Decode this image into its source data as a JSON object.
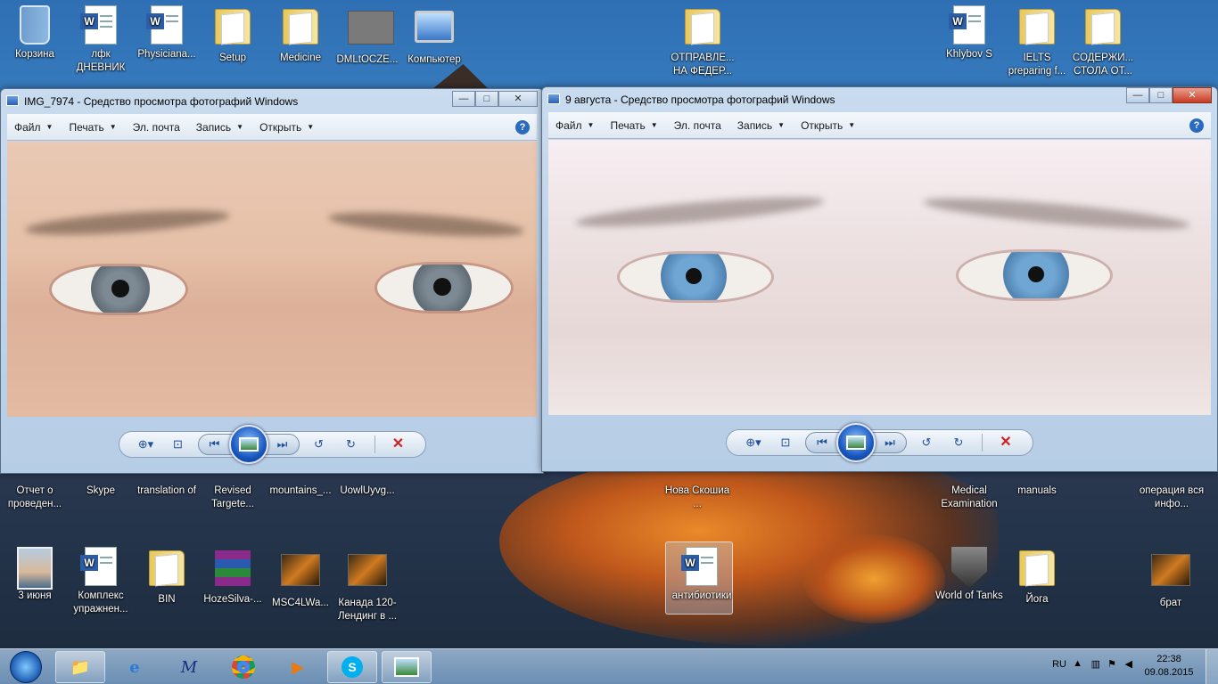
{
  "desktop": {
    "top_icons": [
      {
        "label": "Корзина",
        "kind": "bin"
      },
      {
        "label": "лфк ДНЕВНИК",
        "kind": "doc"
      },
      {
        "label": "Physiciana...",
        "kind": "doc"
      },
      {
        "label": "Setup",
        "kind": "folder"
      },
      {
        "label": "Medicine",
        "kind": "folder"
      },
      {
        "label": "DMLtOCZE...",
        "kind": "gray"
      },
      {
        "label": "Компьютер",
        "kind": "comp"
      },
      {
        "label": "ОТПРАВЛЕ... НА ФЕДЕР...",
        "kind": "folder"
      },
      {
        "label": "Khlybov S",
        "kind": "doc"
      },
      {
        "label": "IELTS preparing f...",
        "kind": "folder"
      },
      {
        "label": "СОДЕРЖИ... СТОЛА ОТ...",
        "kind": "folder"
      }
    ],
    "mid_icons": [
      {
        "label": "Отчет о проведен...",
        "kind": "doc"
      },
      {
        "label": "Skype",
        "kind": "skype"
      },
      {
        "label": "translation of",
        "kind": "pdf"
      },
      {
        "label": "Revised Targete...",
        "kind": "doc"
      },
      {
        "label": "mountains_...",
        "kind": "photo"
      },
      {
        "label": "UowlUyvg...",
        "kind": "photo"
      },
      {
        "label": "Нова Скошиа ...",
        "kind": "doc"
      },
      {
        "label": "Medical Examination",
        "kind": "folder"
      },
      {
        "label": "manuals",
        "kind": "folder"
      },
      {
        "label": "операция вся инфо...",
        "kind": "folder"
      }
    ],
    "bottom_icons": [
      {
        "label": "3 июня",
        "kind": "photo"
      },
      {
        "label": "Комплекс упражнен...",
        "kind": "doc"
      },
      {
        "label": "BIN",
        "kind": "folder"
      },
      {
        "label": "HozeSilva-...",
        "kind": "rar"
      },
      {
        "label": "MSC4LWa...",
        "kind": "vid"
      },
      {
        "label": "Канада 120-Лендинг в ...",
        "kind": "vid"
      },
      {
        "label": "антибиотики",
        "kind": "doc"
      },
      {
        "label": "World of Tanks",
        "kind": "wot"
      },
      {
        "label": "Йога",
        "kind": "folder"
      },
      {
        "label": "брат",
        "kind": "vid"
      }
    ]
  },
  "window_left": {
    "title": "IMG_7974 - Средство просмотра фотографий Windows",
    "menu": [
      "Файл",
      "Печать",
      "Эл. почта",
      "Запись",
      "Открыть"
    ],
    "iris_color": "#7d8a94"
  },
  "window_right": {
    "title": "9 августа - Средство просмотра фотографий Windows",
    "menu": [
      "Файл",
      "Печать",
      "Эл. почта",
      "Запись",
      "Открыть"
    ],
    "iris_color": "#6fa6d4"
  },
  "window_controls": {
    "minimize": "—",
    "maximize": "□",
    "close": "✕"
  },
  "viewer_controls": {
    "zoom": "⊕▾",
    "fit": "⊡",
    "prev": "⏮",
    "next": "⏭",
    "rotate_ccw": "↺",
    "rotate_cw": "↻",
    "delete": "✕"
  },
  "taskbar": {
    "language": "RU",
    "time": "22:38",
    "date": "09.08.2015"
  }
}
